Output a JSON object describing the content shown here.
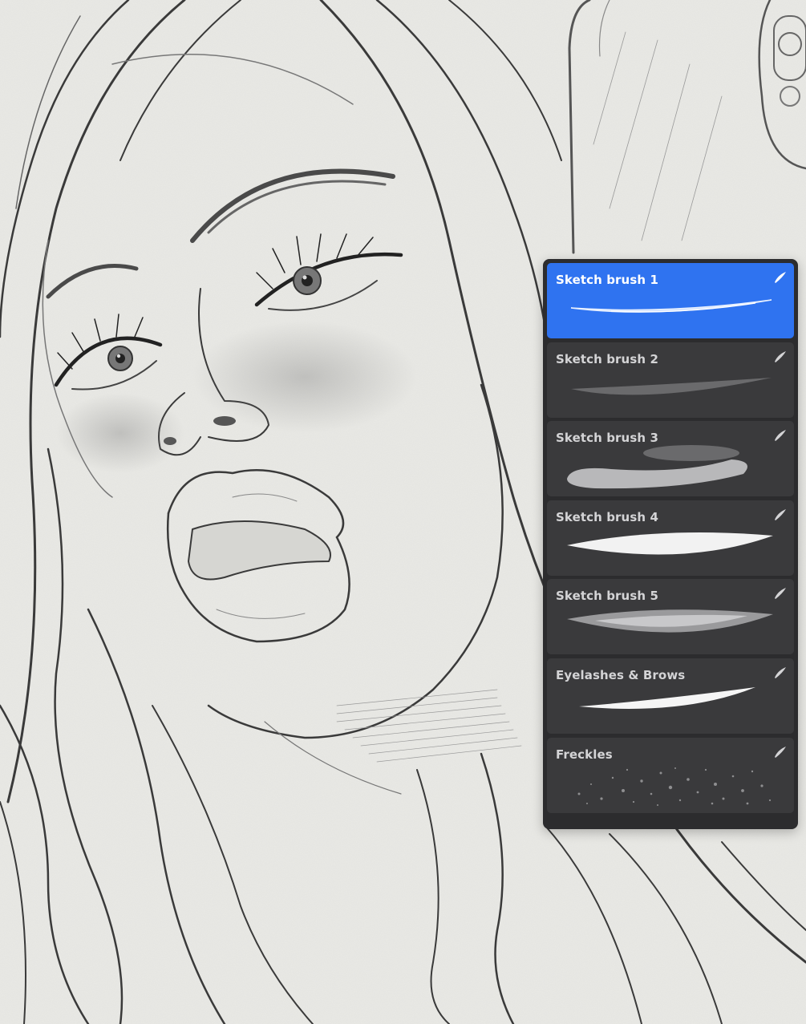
{
  "canvas": {
    "description_icon": "pencil-sketch-artwork"
  },
  "brush_library": {
    "selected_index": 0,
    "accent_color": "#2f73f0",
    "panel_color": "#2c2c2e",
    "row_color": "#3a3a3c",
    "brushes": [
      {
        "label": "Sketch brush 1",
        "icon": "brush-stroke-icon",
        "preview": "thin-blue-taper-stroke"
      },
      {
        "label": "Sketch brush 2",
        "icon": "brush-stroke-icon",
        "preview": "soft-grainy-stroke"
      },
      {
        "label": "Sketch brush 3",
        "icon": "brush-stroke-icon",
        "preview": "airbrush-soft-stroke"
      },
      {
        "label": "Sketch brush 4",
        "icon": "brush-stroke-icon",
        "preview": "solid-taper-stroke"
      },
      {
        "label": "Sketch brush 5",
        "icon": "brush-stroke-icon",
        "preview": "textured-grain-stroke"
      },
      {
        "label": "Eyelashes & Brows",
        "icon": "brush-stroke-icon",
        "preview": "fine-taper-stroke"
      },
      {
        "label": "Freckles",
        "icon": "brush-stroke-icon",
        "preview": "speckle-spray-stroke"
      }
    ]
  }
}
